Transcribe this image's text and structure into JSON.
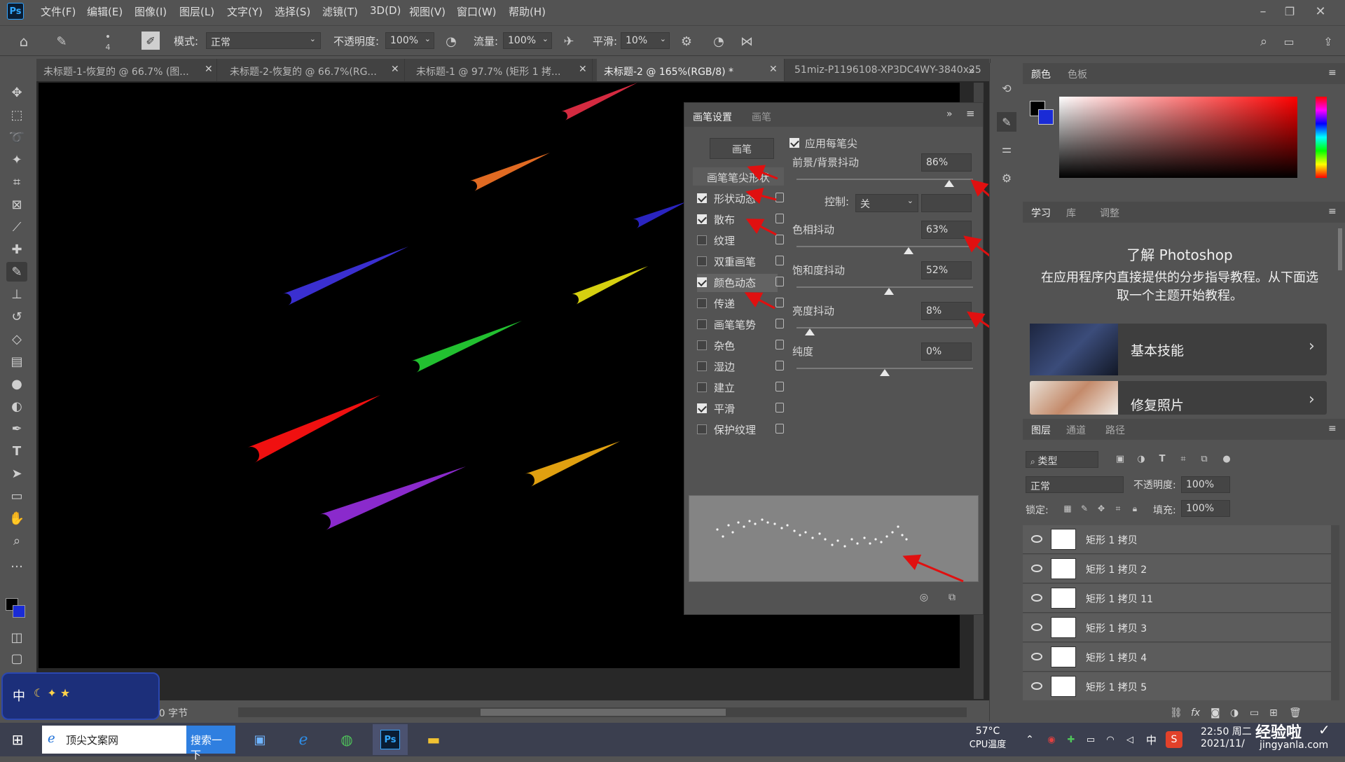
{
  "app": {
    "logo": "Ps"
  },
  "menu": [
    "文件(F)",
    "编辑(E)",
    "图像(I)",
    "图层(L)",
    "文字(Y)",
    "选择(S)",
    "滤镜(T)",
    "3D(D)",
    "视图(V)",
    "窗口(W)",
    "帮助(H)"
  ],
  "options": {
    "brush_size": "4",
    "mode_label": "模式:",
    "mode_value": "正常",
    "opacity_label": "不透明度:",
    "opacity_value": "100%",
    "flow_label": "流量:",
    "flow_value": "100%",
    "smooth_label": "平滑:",
    "smooth_value": "10%"
  },
  "tabs": [
    {
      "label": "未标题-1-恢复的 @ 66.7% (图..."
    },
    {
      "label": "未标题-2-恢复的 @ 66.7%(RG..."
    },
    {
      "label": "未标题-1 @ 97.7% (矩形 1 拷..."
    },
    {
      "label": "未标题-2 @ 165%(RGB/8) *",
      "active": true
    },
    {
      "label": "51miz-P1196108-XP3DC4WY-3840x25"
    }
  ],
  "brush_panel": {
    "tab_settings": "画笔设置",
    "tab_brush": "画笔",
    "brush_button": "画笔",
    "tip_shape": "画笔笔尖形状",
    "items": [
      {
        "label": "形状动态",
        "checked": true
      },
      {
        "label": "散布",
        "checked": true
      },
      {
        "label": "纹理",
        "checked": false
      },
      {
        "label": "双重画笔",
        "checked": false
      },
      {
        "label": "颜色动态",
        "checked": true
      },
      {
        "label": "传递",
        "checked": false
      },
      {
        "label": "画笔笔势",
        "checked": false
      },
      {
        "label": "杂色",
        "checked": false
      },
      {
        "label": "湿边",
        "checked": false
      },
      {
        "label": "建立",
        "checked": false
      },
      {
        "label": "平滑",
        "checked": true
      },
      {
        "label": "保护纹理",
        "checked": false
      }
    ],
    "apply_per_tip": "应用每笔尖",
    "fg_bg_jitter_label": "前景/背景抖动",
    "fg_bg_jitter": "86%",
    "control_label": "控制:",
    "control_value": "关",
    "hue_label": "色相抖动",
    "hue": "63%",
    "sat_label": "饱和度抖动",
    "sat": "52%",
    "bright_label": "亮度抖动",
    "bright": "8%",
    "purity_label": "纯度",
    "purity": "0%"
  },
  "color_panel": {
    "tab_color": "颜色",
    "tab_swatches": "色板",
    "fg_color": "#000000",
    "bg_color": "#1a2bd6"
  },
  "learn_panel": {
    "tab_learn": "学习",
    "tab_library": "库",
    "tab_adjust": "调整",
    "title": "了解 Photoshop",
    "desc": "在应用程序内直接提供的分步指导教程。从下面选取一个主题开始教程。",
    "card1": "基本技能",
    "card2": "修复照片"
  },
  "layers_panel": {
    "tab_layers": "图层",
    "tab_channels": "通道",
    "tab_paths": "路径",
    "filter_label": "类型",
    "blend": "正常",
    "opacity_label": "不透明度:",
    "opacity": "100%",
    "lock_label": "锁定:",
    "fill_label": "填充:",
    "fill": "100%",
    "layers": [
      "矩形 1 拷贝",
      "矩形 1 拷贝 2",
      "矩形 1 拷贝 11",
      "矩形 1 拷贝 3",
      "矩形 1 拷贝 4",
      "矩形 1 拷贝 5"
    ]
  },
  "status": {
    "info": "/0 字节"
  },
  "ime": {
    "text": "中"
  },
  "taskbar": {
    "search_text": "顶尖文案网",
    "search_button": "搜索一下",
    "temp": "57°C",
    "temp_label": "CPU温度",
    "time": "22:50 周二",
    "date": "2021/11/",
    "lang": "中",
    "watermark": "经验啦",
    "watermark_url": "jingyanla.com"
  },
  "streak_colors": [
    "#d42a40",
    "#e06a22",
    "#3a2fd0",
    "#d6d010",
    "#22c030",
    "#f01010",
    "#e0a010",
    "#8a2acc",
    "#2a24c0"
  ]
}
